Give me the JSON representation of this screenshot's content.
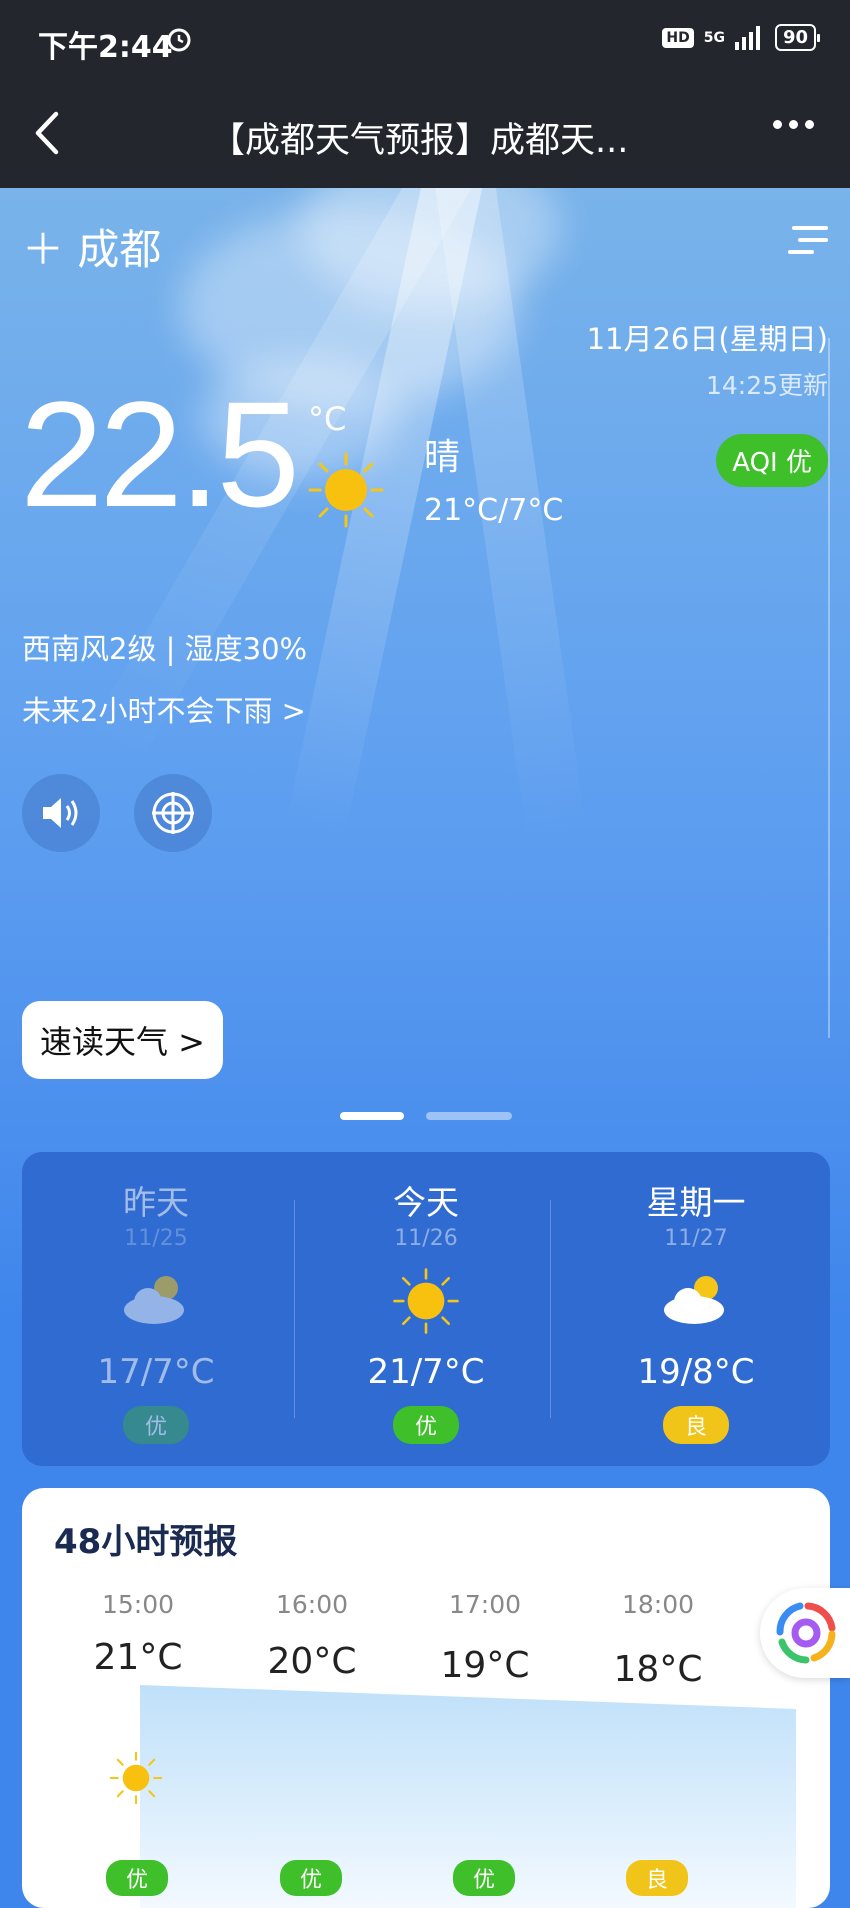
{
  "status": {
    "time": "下午2:44",
    "hd": "HD",
    "network": "5G",
    "battery": "90"
  },
  "appbar": {
    "title": "【成都天气预报】成都天..."
  },
  "hero": {
    "city": "成都",
    "date": "11月26日(星期日)",
    "update": "14:25更新",
    "aqi": "AQI 优",
    "temperature": "22.5",
    "unit": "°C",
    "condition": "晴",
    "range": "21°C/7°C",
    "wind_humidity": "西南风2级 | 湿度30%",
    "rain_notice": "未来2小时不会下雨 >",
    "speed_read": "速读天气 >"
  },
  "days": [
    {
      "name": "昨天",
      "date": "11/25",
      "temp": "17/7°C",
      "aqi": "优",
      "icon": "partly-cloudy-icon",
      "aqi_color": "#3aa35a"
    },
    {
      "name": "今天",
      "date": "11/26",
      "temp": "21/7°C",
      "aqi": "优",
      "icon": "sun-icon",
      "aqi_color": "#3fbf2a"
    },
    {
      "name": "星期一",
      "date": "11/27",
      "temp": "19/8°C",
      "aqi": "良",
      "icon": "partly-cloudy-icon",
      "aqi_color": "#f0c419"
    }
  ],
  "hourly": {
    "title": "48小时预报",
    "items": [
      {
        "time": "15:00",
        "temp": "21°C",
        "aqi": "优",
        "aqi_color": "#3fbf2a"
      },
      {
        "time": "16:00",
        "temp": "20°C",
        "aqi": "优",
        "aqi_color": "#3fbf2a"
      },
      {
        "time": "17:00",
        "temp": "19°C",
        "aqi": "优",
        "aqi_color": "#3fbf2a"
      },
      {
        "time": "18:00",
        "temp": "18°C",
        "aqi": "良",
        "aqi_color": "#f0c419"
      }
    ]
  }
}
